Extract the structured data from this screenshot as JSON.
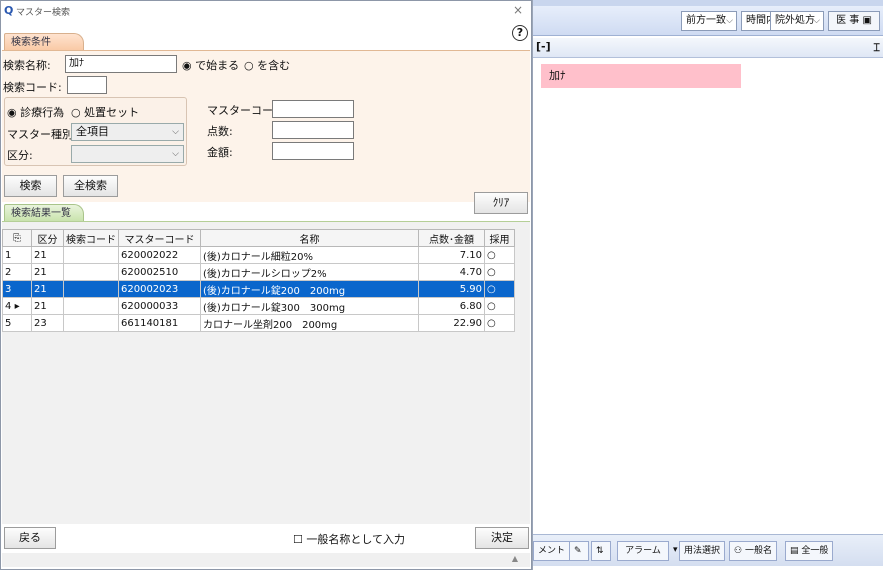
{
  "dialog": {
    "title": "マスター検索",
    "close": "×",
    "help": "?",
    "condition_tab": "検索条件",
    "result_tab": "検索結果一覧",
    "search_name_label": "検索名称:",
    "search_name_value": "加ﾅ",
    "radio_starts": "で始まる",
    "radio_contains": "を含む",
    "search_code_label": "検索コード:",
    "radio_treatment": "診療行為",
    "radio_set": "処置セット",
    "master_type_label": "マスター種別:",
    "master_type_value": "全項目",
    "category_label": "区分:",
    "master_code_label": "マスターコード:",
    "points_label": "点数:",
    "amount_label": "金額:",
    "search_button": "検索",
    "search_all_button": "全検索",
    "clear_button": "ｸﾘｱ",
    "back_button": "戻る",
    "general_name_checkbox": "一般名称として入力",
    "confirm_button": "決定"
  },
  "grid": {
    "columns": [
      "区分",
      "検索コード",
      "マスターコード",
      "名称",
      "点数･金額",
      "採用"
    ],
    "rows": [
      {
        "no": "1",
        "mark": "",
        "kubun": "21",
        "code": "",
        "master": "620002022",
        "name": "(後)カロナール細粒20%",
        "points": "7.10",
        "adopt": "○"
      },
      {
        "no": "2",
        "mark": "",
        "kubun": "21",
        "code": "",
        "master": "620002510",
        "name": "(後)カロナールシロップ2%",
        "points": "4.70",
        "adopt": "○"
      },
      {
        "no": "3",
        "mark": "",
        "kubun": "21",
        "code": "",
        "master": "620002023",
        "name": "(後)カロナール錠200　200mg",
        "points": "5.90",
        "adopt": "○"
      },
      {
        "no": "4",
        "mark": "▸",
        "kubun": "21",
        "code": "",
        "master": "620000033",
        "name": "(後)カロナール錠300　300mg",
        "points": "6.80",
        "adopt": "○"
      },
      {
        "no": "5",
        "mark": "",
        "kubun": "23",
        "code": "",
        "master": "661140181",
        "name": "カロナール坐剤200　200mg",
        "points": "22.90",
        "adopt": "○"
      }
    ]
  },
  "background": {
    "select1": "前方一致",
    "select2": "時間内",
    "select3": "院外処方",
    "doc_button": "医 事",
    "panel_head": "[-]",
    "chip_text": "加ﾅ",
    "bottom_items": [
      "メント",
      "アラーム",
      "用法選択",
      "一般名",
      "全一般"
    ]
  }
}
